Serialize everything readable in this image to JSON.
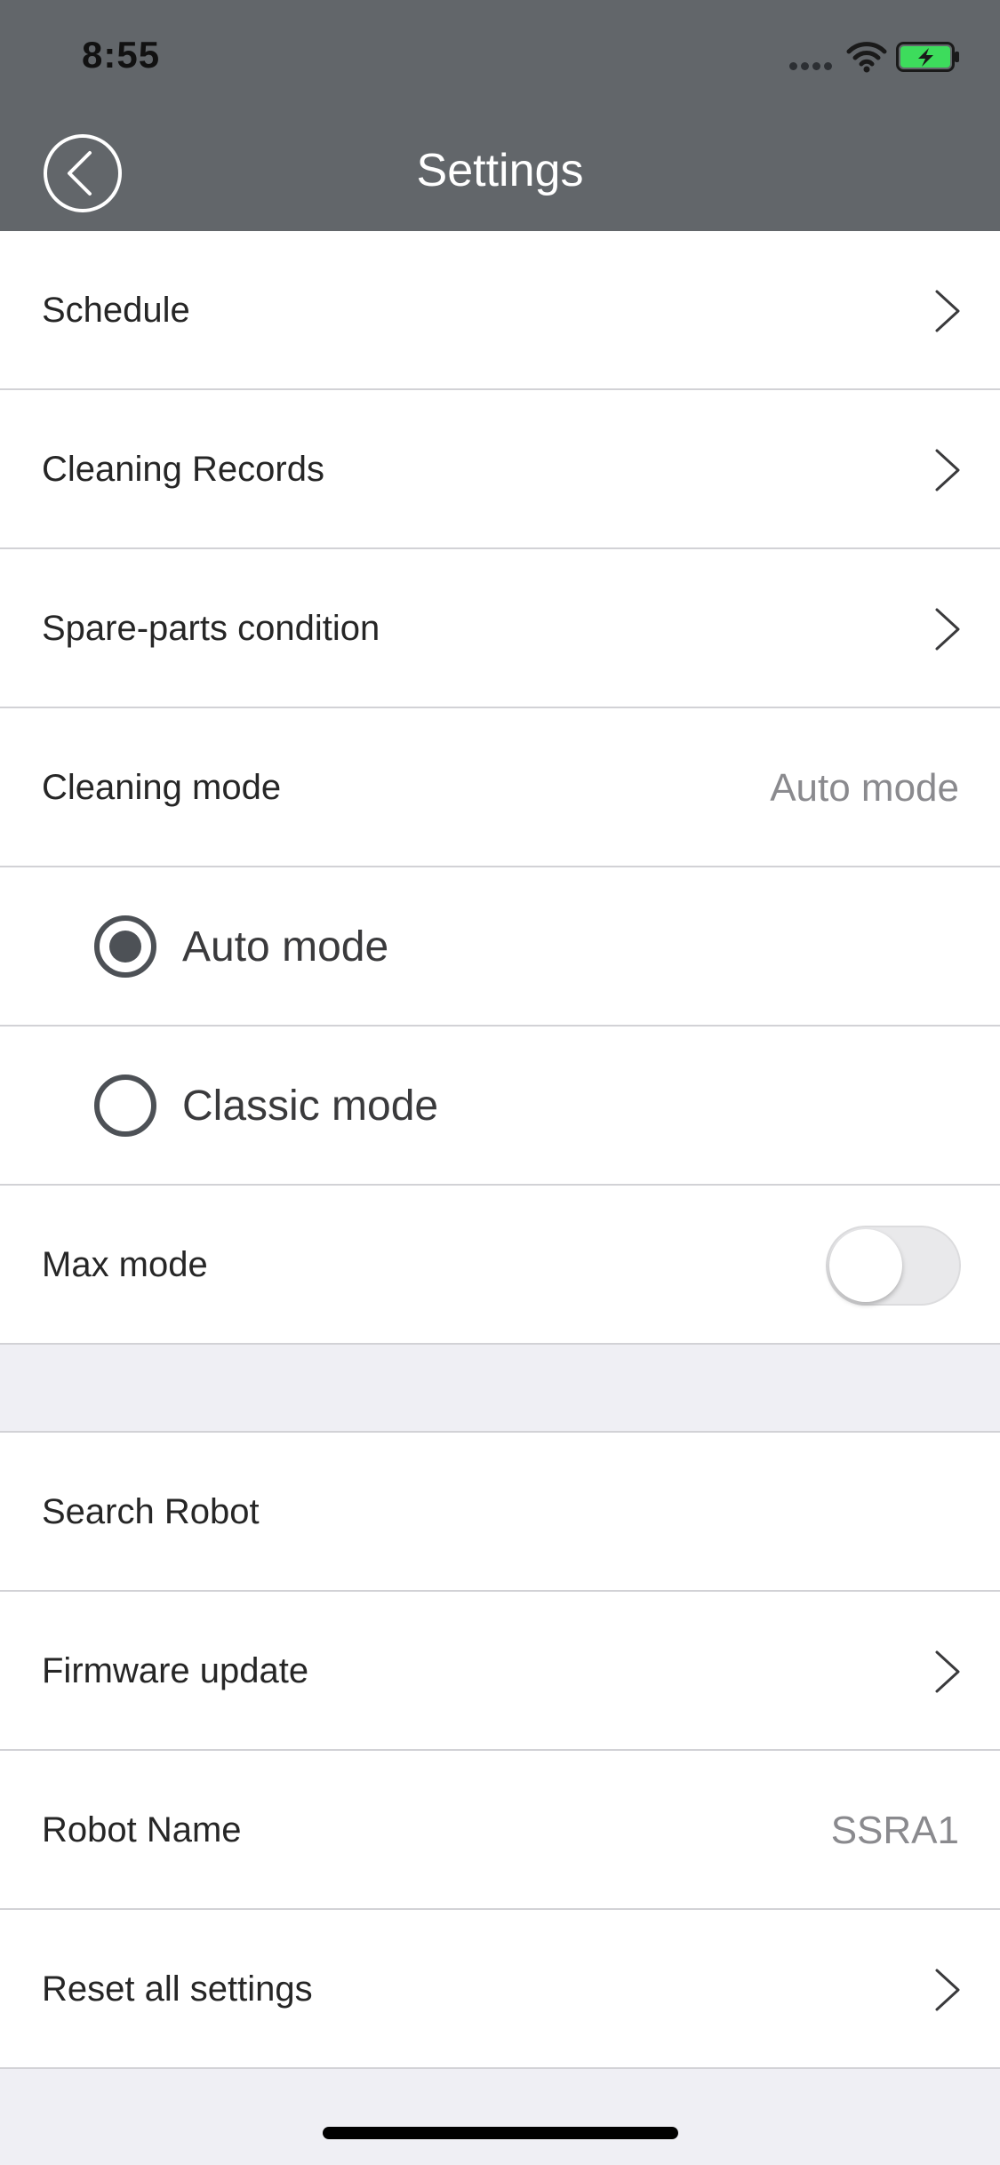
{
  "status_bar": {
    "time": "8:55"
  },
  "nav": {
    "title": "Settings"
  },
  "group_1": {
    "schedule": "Schedule",
    "cleaning_records": "Cleaning Records",
    "spare_parts": "Spare-parts condition",
    "cleaning_mode": "Cleaning mode",
    "cleaning_mode_value": "Auto mode",
    "auto_mode": "Auto mode",
    "classic_mode": "Classic mode",
    "selected_mode": "Auto mode",
    "max_mode": "Max mode",
    "max_mode_enabled": false
  },
  "group_2": {
    "search_robot": "Search Robot",
    "firmware_update": "Firmware update",
    "robot_name": "Robot Name",
    "robot_name_value": "SSRA1",
    "reset_settings": "Reset all settings"
  },
  "colors": {
    "header": "#62666a",
    "background": "#efeff4",
    "radio_active": "#4d5156",
    "battery_fill": "#3ddc5c"
  },
  "icons": {
    "back": "chevron-left-circle-icon",
    "row_arrow": "chevron-right-icon",
    "wifi": "wifi-icon",
    "battery": "battery-charging-icon"
  }
}
